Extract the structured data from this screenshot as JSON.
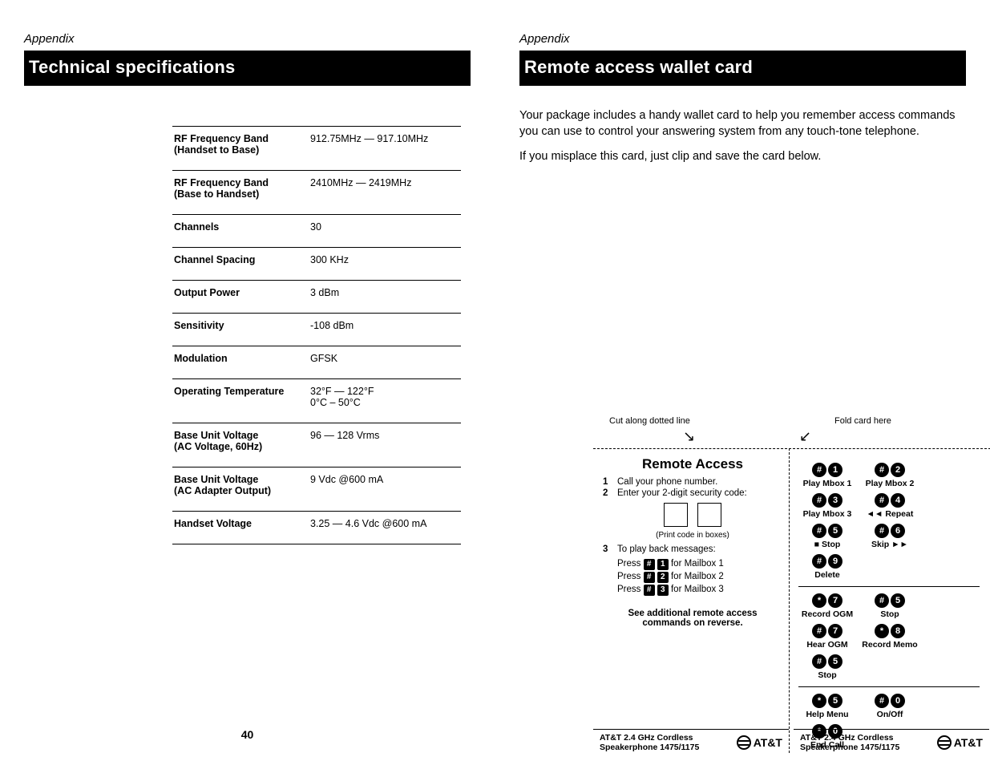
{
  "left_page": {
    "appendix": "Appendix",
    "title": "Technical specifications",
    "page_number": "40",
    "specs": [
      {
        "label": "RF Frequency Band\n(Handset to Base)",
        "value": "912.75MHz — 917.10MHz"
      },
      {
        "label": "RF Frequency Band\n(Base to Handset)",
        "value": "2410MHz — 2419MHz"
      },
      {
        "label": "Channels",
        "value": "30"
      },
      {
        "label": "Channel Spacing",
        "value": "300 KHz"
      },
      {
        "label": "Output Power",
        "value": "3 dBm"
      },
      {
        "label": "Sensitivity",
        "value": "-108 dBm"
      },
      {
        "label": "Modulation",
        "value": "GFSK"
      },
      {
        "label": "Operating Temperature",
        "value": "32°F — 122°F\n0°C – 50°C"
      },
      {
        "label": "Base Unit Voltage\n(AC Voltage, 60Hz)",
        "value": "96 — 128 Vrms"
      },
      {
        "label": "Base Unit Voltage\n(AC Adapter Output)",
        "value": "9 Vdc @600 mA"
      },
      {
        "label": "Handset Voltage",
        "value": "3.25 — 4.6 Vdc @600 mA"
      }
    ]
  },
  "right_page": {
    "appendix": "Appendix",
    "title": "Remote access wallet card",
    "para1": "Your package includes a handy wallet card to help you remember access commands you can use to control your answering system from any touch-tone telephone.",
    "para2": "If you misplace this card, just clip and save the card below."
  },
  "card": {
    "cut_label": "Cut along dotted line",
    "fold_label": "Fold card here",
    "ra_title": "Remote Access",
    "steps": {
      "s1": "Call your phone number.",
      "s2": "Enter your 2-digit security code:",
      "s3": "To play back messages:"
    },
    "print_hint": "(Print code in boxes)",
    "playbacks": [
      {
        "prefix": "Press ",
        "k1": "#",
        "k2": "1",
        "suffix": " for Mailbox 1"
      },
      {
        "prefix": "Press ",
        "k1": "#",
        "k2": "2",
        "suffix": " for Mailbox 2"
      },
      {
        "prefix": "Press ",
        "k1": "#",
        "k2": "3",
        "suffix": " for Mailbox 3"
      }
    ],
    "reverse_note": "See additional remote access commands on reverse.",
    "groups": [
      [
        {
          "k1": "#",
          "k2": "1",
          "label": "Play Mbox 1"
        },
        {
          "k1": "#",
          "k2": "2",
          "label": "Play Mbox 2"
        },
        {
          "k1": "#",
          "k2": "3",
          "label": "Play Mbox 3"
        },
        {
          "k1": "#",
          "k2": "4",
          "label": "◄◄ Repeat"
        },
        {
          "k1": "#",
          "k2": "5",
          "label": "■ Stop"
        },
        {
          "k1": "#",
          "k2": "6",
          "label": "Skip ►►"
        },
        {
          "k1": "#",
          "k2": "9",
          "label": "Delete"
        }
      ],
      [
        {
          "k1": "*",
          "k2": "7",
          "label": "Record OGM"
        },
        {
          "k1": "#",
          "k2": "5",
          "label": "Stop"
        },
        {
          "k1": "#",
          "k2": "7",
          "label": "Hear OGM"
        },
        {
          "k1": "*",
          "k2": "8",
          "label": "Record Memo"
        },
        {
          "k1": "#",
          "k2": "5",
          "label": "Stop"
        }
      ],
      [
        {
          "k1": "*",
          "k2": "5",
          "label": "Help Menu"
        },
        {
          "k1": "#",
          "k2": "0",
          "label": "On/Off"
        },
        {
          "k1": "*",
          "k2": "0",
          "label": "End Call"
        }
      ]
    ],
    "footer_product": "AT&T 2.4 GHz Cordless\nSpeakerphone 1475/1175",
    "brand": "AT&T"
  }
}
